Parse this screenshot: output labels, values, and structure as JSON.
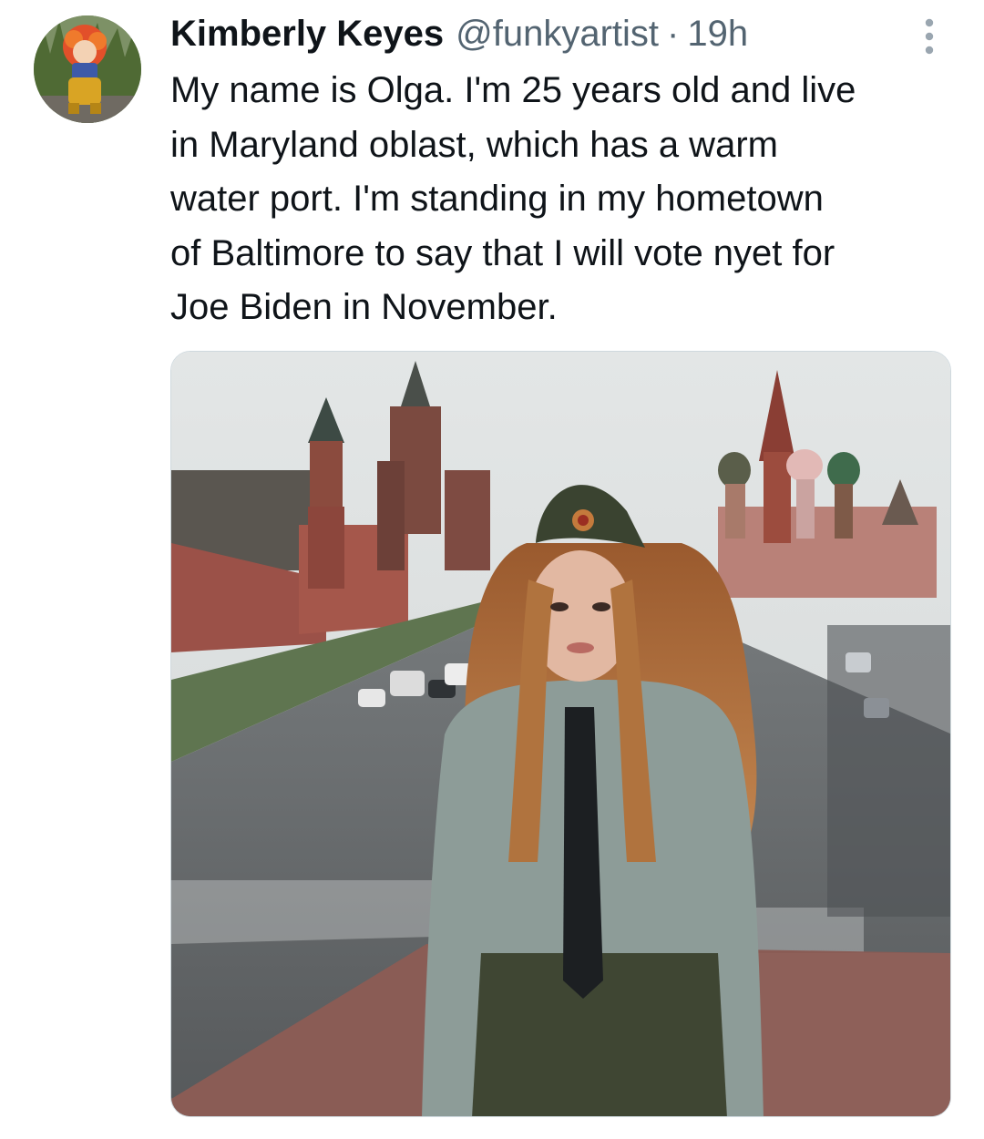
{
  "tweet": {
    "display_name": "Kimberly Keyes",
    "handle": "@funkyartist",
    "separator": "·",
    "time": "19h",
    "text": "My name is Olga. I'm 25 years old and live\nin Maryland oblast, which has a warm\nwater port. I'm standing in my hometown\nof Baltimore to say that I will vote nyet for\nJoe Biden in November.",
    "avatar_icon": "avatar-image",
    "more_icon": "more-vertical-icon",
    "media_icon": "photo-image"
  },
  "colors": {
    "text_primary": "#0f1419",
    "text_secondary": "#536471",
    "border": "#cfd9de"
  }
}
